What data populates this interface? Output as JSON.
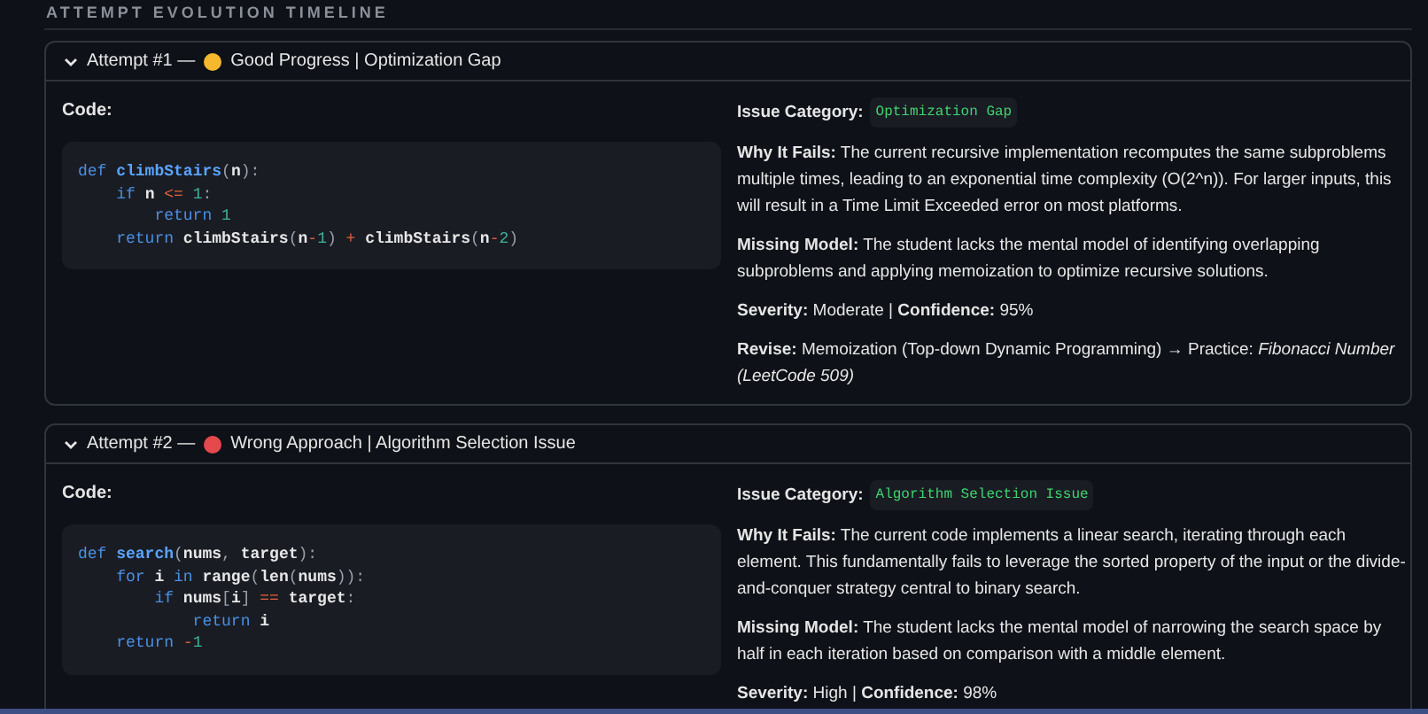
{
  "section_title": "ATTEMPT EVOLUTION TIMELINE",
  "attempts": [
    {
      "label": "Attempt #1 —",
      "status": "Good Progress | Optimization Gap",
      "color": "#f5b82e",
      "expanded": true,
      "code_label": "Code:",
      "code": [
        [
          {
            "text": "def ",
            "kind": "keyword"
          },
          {
            "text": "climbStairs",
            "kind": "function"
          },
          {
            "text": "(",
            "kind": "punct"
          },
          {
            "text": "n",
            "kind": "plain"
          },
          {
            "text": "):",
            "kind": "punct"
          }
        ],
        [
          {
            "text": "    if ",
            "kind": "keyword"
          },
          {
            "text": "n ",
            "kind": "plain"
          },
          {
            "text": "<= ",
            "kind": "operator"
          },
          {
            "text": "1",
            "kind": "number"
          },
          {
            "text": ":",
            "kind": "punct"
          }
        ],
        [
          {
            "text": "        return ",
            "kind": "keyword"
          },
          {
            "text": "1",
            "kind": "number"
          }
        ],
        [
          {
            "text": "    return ",
            "kind": "keyword"
          },
          {
            "text": "climbStairs",
            "kind": "plain"
          },
          {
            "text": "(",
            "kind": "punct"
          },
          {
            "text": "n",
            "kind": "plain"
          },
          {
            "text": "-",
            "kind": "operator"
          },
          {
            "text": "1",
            "kind": "number"
          },
          {
            "text": ") ",
            "kind": "punct"
          },
          {
            "text": "+ ",
            "kind": "operator"
          },
          {
            "text": "climbStairs",
            "kind": "plain"
          },
          {
            "text": "(",
            "kind": "punct"
          },
          {
            "text": "n",
            "kind": "plain"
          },
          {
            "text": "-",
            "kind": "operator"
          },
          {
            "text": "2",
            "kind": "number"
          },
          {
            "text": ")",
            "kind": "punct"
          }
        ]
      ],
      "issue_label": "Issue Category:",
      "issue_category": "Optimization Gap",
      "paragraphs": [
        "**Why It Fails:** The current recursive implementation recomputes the same subproblems multiple times, leading to an exponential time complexity (O(2^n)). For larger inputs, this will result in a Time Limit Exceeded error on most platforms.",
        "**Missing Model:** The student lacks the mental model of identifying overlapping subproblems and applying memoization to optimize recursive solutions.",
        "**Severity:** Moderate | **Confidence:** 95%",
        "**Revise:** Memoization (Top-down Dynamic Programming) → Practice: *Fibonacci Number (LeetCode 509)*"
      ]
    },
    {
      "label": "Attempt #2 —",
      "status": "Wrong Approach | Algorithm Selection Issue",
      "color": "#e5484d",
      "expanded": true,
      "code_label": "Code:",
      "code": [
        [
          {
            "text": "def ",
            "kind": "keyword"
          },
          {
            "text": "search",
            "kind": "function"
          },
          {
            "text": "(",
            "kind": "punct"
          },
          {
            "text": "nums",
            "kind": "plain"
          },
          {
            "text": ", ",
            "kind": "punct"
          },
          {
            "text": "target",
            "kind": "plain"
          },
          {
            "text": "):",
            "kind": "punct"
          }
        ],
        [
          {
            "text": "    for ",
            "kind": "keyword"
          },
          {
            "text": "i ",
            "kind": "plain"
          },
          {
            "text": "in ",
            "kind": "keyword"
          },
          {
            "text": "range",
            "kind": "plain"
          },
          {
            "text": "(",
            "kind": "punct"
          },
          {
            "text": "len",
            "kind": "plain"
          },
          {
            "text": "(",
            "kind": "punct"
          },
          {
            "text": "nums",
            "kind": "plain"
          },
          {
            "text": ")):",
            "kind": "punct"
          }
        ],
        [
          {
            "text": "        if ",
            "kind": "keyword"
          },
          {
            "text": "nums",
            "kind": "plain"
          },
          {
            "text": "[",
            "kind": "punct"
          },
          {
            "text": "i",
            "kind": "plain"
          },
          {
            "text": "] ",
            "kind": "punct"
          },
          {
            "text": "== ",
            "kind": "operator"
          },
          {
            "text": "target",
            "kind": "plain"
          },
          {
            "text": ":",
            "kind": "punct"
          }
        ],
        [
          {
            "text": "            return ",
            "kind": "keyword"
          },
          {
            "text": "i",
            "kind": "plain"
          }
        ],
        [
          {
            "text": "    return ",
            "kind": "keyword"
          },
          {
            "text": "-",
            "kind": "operator"
          },
          {
            "text": "1",
            "kind": "number"
          }
        ]
      ],
      "issue_label": "Issue Category:",
      "issue_category": "Algorithm Selection Issue",
      "paragraphs": [
        "**Why It Fails:** The current code implements a linear search, iterating through each element. This fundamentally fails to leverage the sorted property of the input or the divide-and-conquer strategy central to binary search.",
        "**Missing Model:** The student lacks the mental model of narrowing the search space by half in each iteration based on comparison with a middle element.",
        "**Severity:** High | **Confidence:** 98%"
      ]
    }
  ]
}
